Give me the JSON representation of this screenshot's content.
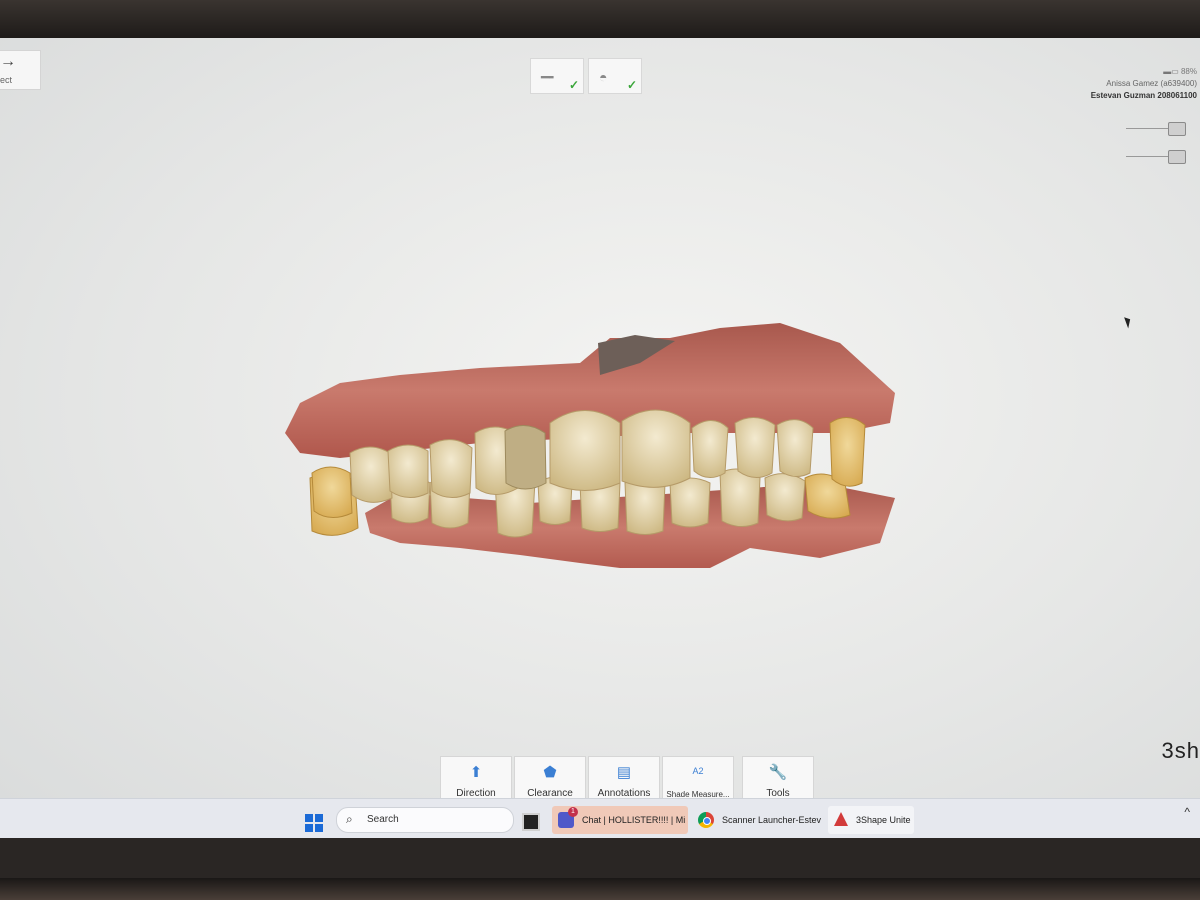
{
  "top_left": {
    "next_label": "ect",
    "next_icon": "arrow-right-icon"
  },
  "workflow_steps": [
    {
      "name": "scan-step",
      "icon": "scanner-wand-icon",
      "status": "done"
    },
    {
      "name": "bite-step",
      "icon": "tooth-icon",
      "status": "done"
    }
  ],
  "patient": {
    "zoom": "88%",
    "doctor": "Anissa Gamez (a639400)",
    "case": "Estevan Guzman 208061100"
  },
  "brand": "3sh",
  "toolbar": {
    "direction": "Direction",
    "clearance": "Clearance",
    "annotations": "Annotations",
    "shade": "Shade Measure...",
    "shade_badge": "A2",
    "tools": "Tools"
  },
  "taskbar": {
    "search": "Search",
    "teams_badge": "1",
    "teams": "Chat | HOLLISTER!!!! | Mi",
    "chrome": "Scanner Launcher-Estev",
    "unite": "3Shape Unite",
    "chevron": "^"
  },
  "colors": {
    "accent": "#3b7fd3",
    "check": "#3aa63a",
    "gum": "#b25a52",
    "tooth": "#e8d9a6"
  }
}
